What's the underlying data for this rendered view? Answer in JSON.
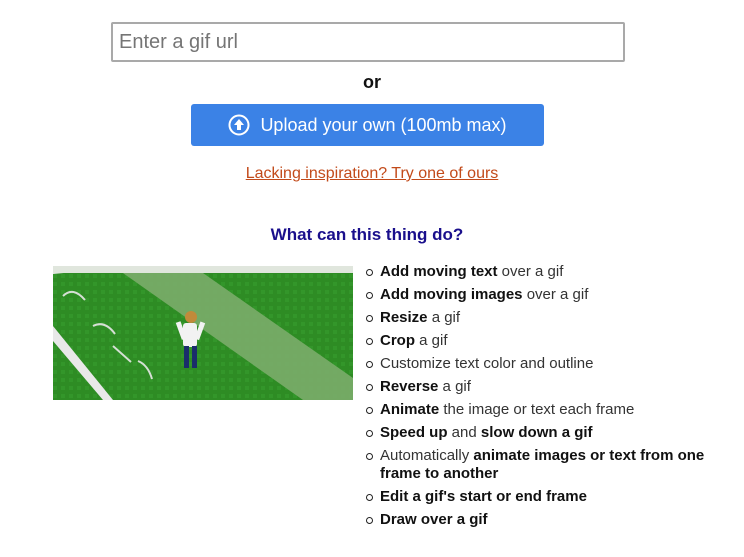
{
  "url_input": {
    "placeholder": "Enter a gif url",
    "value": ""
  },
  "or_label": "or",
  "upload_button": {
    "label": "Upload your own (100mb max)",
    "icon": "upload-arrow-circle-icon"
  },
  "inspiration_link": "Lacking inspiration? Try one of ours",
  "features_heading": "What can this thing do?",
  "features": [
    [
      {
        "t": "Add moving text",
        "b": true
      },
      {
        "t": " over a gif",
        "b": false
      }
    ],
    [
      {
        "t": "Add moving images",
        "b": true
      },
      {
        "t": " over a gif",
        "b": false
      }
    ],
    [
      {
        "t": "Resize",
        "b": true
      },
      {
        "t": " a gif",
        "b": false
      }
    ],
    [
      {
        "t": "Crop",
        "b": true
      },
      {
        "t": " a gif",
        "b": false
      }
    ],
    [
      {
        "t": "Customize text color and outline",
        "b": false
      }
    ],
    [
      {
        "t": "Reverse",
        "b": true
      },
      {
        "t": " a gif",
        "b": false
      }
    ],
    [
      {
        "t": "Animate",
        "b": true
      },
      {
        "t": " the image or text each frame",
        "b": false
      }
    ],
    [
      {
        "t": "Speed up",
        "b": true
      },
      {
        "t": " and ",
        "b": false
      },
      {
        "t": "slow down a gif",
        "b": true
      }
    ],
    [
      {
        "t": "Automatically ",
        "b": false
      },
      {
        "t": "animate images or text from one frame to another",
        "b": true
      }
    ],
    [
      {
        "t": "Edit a gif's start or end frame",
        "b": true
      }
    ],
    [
      {
        "t": "Draw over a gif",
        "b": true
      }
    ]
  ],
  "colors": {
    "button_bg": "#3b82e6",
    "link": "#c24a1a",
    "heading": "#1a0f8c"
  }
}
